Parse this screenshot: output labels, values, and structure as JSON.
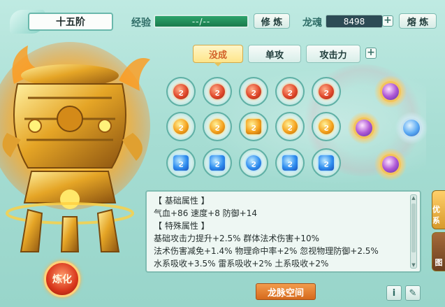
{
  "header": {
    "rank": "十五阶",
    "exp_label": "经验",
    "exp_value": "--/--",
    "refine_label": "修 炼",
    "soul_label": "龙魂",
    "soul_value": "8498",
    "smelt_label": "熔 炼"
  },
  "tabs": [
    {
      "label": "没成",
      "active": true
    },
    {
      "label": "单攻",
      "active": false
    },
    {
      "label": "攻击力",
      "active": false
    }
  ],
  "gems": {
    "row1": [
      "red",
      "red",
      "red",
      "red",
      "red"
    ],
    "row2": [
      "orange",
      "orange",
      "orange",
      "orange",
      "orange"
    ],
    "row3": [
      "blue",
      "blue",
      "blue",
      "blue",
      "blue"
    ]
  },
  "attributes": {
    "base_header": "【 基础属性 】",
    "base_line": "气血+86  速度+8  防御+14",
    "special_header": "【 特殊属性 】",
    "special_line1": "基础攻击力提升+2.5%  群体法术伤害+10%",
    "special_line2": "法术伤害减免+1.4%  物理命中率+2%  忽视物理防御+2.5%",
    "special_line3": "水系吸收+3.5%  雷系吸收+2%  土系吸收+2%"
  },
  "bottom": {
    "refine_button": "炼化",
    "space_button": "龙脉空间",
    "info_button": "i",
    "log_button": "✎"
  },
  "side_tabs": [
    "优系",
    "图"
  ],
  "icons": {
    "plus": "+",
    "scroll_up": "▲",
    "scroll_down": "▼"
  }
}
